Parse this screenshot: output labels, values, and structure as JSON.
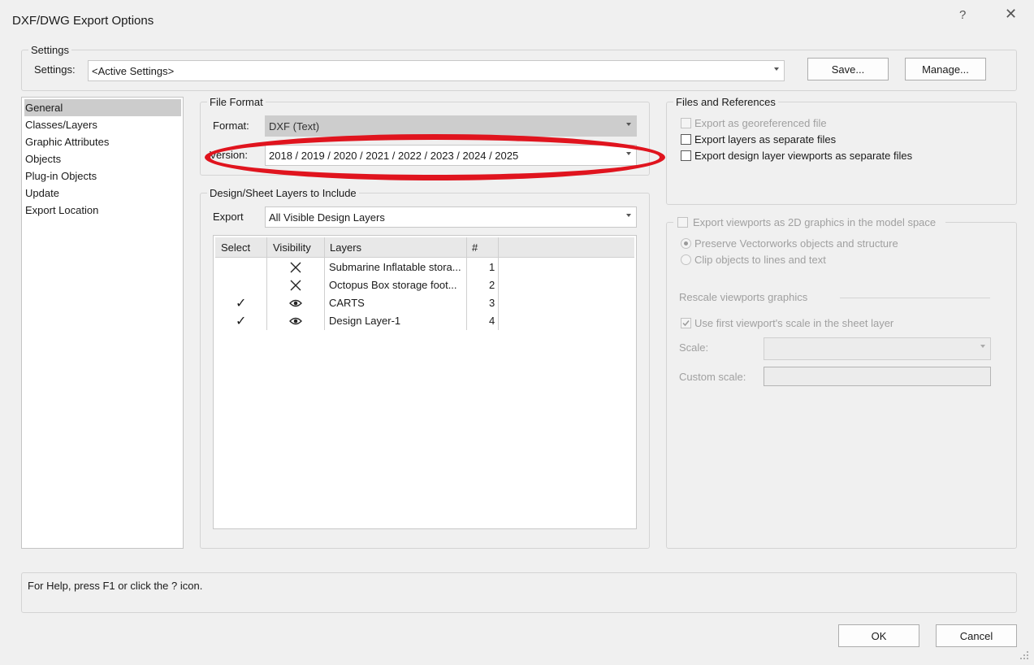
{
  "window": {
    "title": "DXF/DWG Export Options",
    "help_label": "?",
    "close_label": "✕"
  },
  "settings_group": {
    "legend": "Settings",
    "label": "Settings:",
    "value": "<Active Settings>",
    "save_label": "Save...",
    "manage_label": "Manage..."
  },
  "sidebar": {
    "items": [
      {
        "label": "General",
        "selected": true
      },
      {
        "label": "Classes/Layers"
      },
      {
        "label": "Graphic Attributes"
      },
      {
        "label": "Objects"
      },
      {
        "label": "Plug-in Objects"
      },
      {
        "label": "Update"
      },
      {
        "label": "Export Location"
      }
    ]
  },
  "file_format": {
    "legend": "File Format",
    "format_label": "Format:",
    "format_value": "DXF (Text)",
    "version_label": "Version:",
    "version_value": "2018 / 2019 / 2020 / 2021 / 2022 / 2023 / 2024 / 2025"
  },
  "layers_group": {
    "legend": "Design/Sheet Layers to Include",
    "export_label": "Export",
    "export_value": "All Visible Design Layers",
    "columns": {
      "select": "Select",
      "visibility": "Visibility",
      "layers": "Layers",
      "number": "#"
    },
    "rows": [
      {
        "select": "",
        "visibility": "hidden-x-icon",
        "name": "Submarine Inflatable stora...",
        "number": "1"
      },
      {
        "select": "",
        "visibility": "hidden-x-icon",
        "name": "Octopus Box storage foot...",
        "number": "2"
      },
      {
        "select": "✓",
        "visibility": "eye-icon",
        "name": "CARTS",
        "number": "3"
      },
      {
        "select": "✓",
        "visibility": "eye-icon",
        "name": "Design Layer-1",
        "number": "4"
      }
    ]
  },
  "files_refs": {
    "legend": "Files and References",
    "georeferenced": {
      "label": "Export as georeferenced file",
      "checked": false,
      "enabled": false
    },
    "layers_separate": {
      "label": "Export layers as separate files",
      "checked": false,
      "enabled": true
    },
    "viewports_separate": {
      "label": "Export design layer viewports as separate files",
      "checked": false,
      "enabled": true
    }
  },
  "viewports": {
    "legend_label": "Export viewports as 2D graphics in the model space",
    "preserve_label": "Preserve Vectorworks objects and structure",
    "clip_label": "Clip objects to lines and text",
    "rescale_label": "Rescale viewports graphics",
    "use_first_label": "Use first viewport's scale in the sheet layer",
    "scale_label": "Scale:",
    "custom_scale_label": "Custom scale:"
  },
  "status": {
    "text": "For Help, press F1 or click the ? icon."
  },
  "footer": {
    "ok_label": "OK",
    "cancel_label": "Cancel"
  },
  "colors": {
    "annotation": "#e0141e",
    "selection": "#cccccc"
  }
}
